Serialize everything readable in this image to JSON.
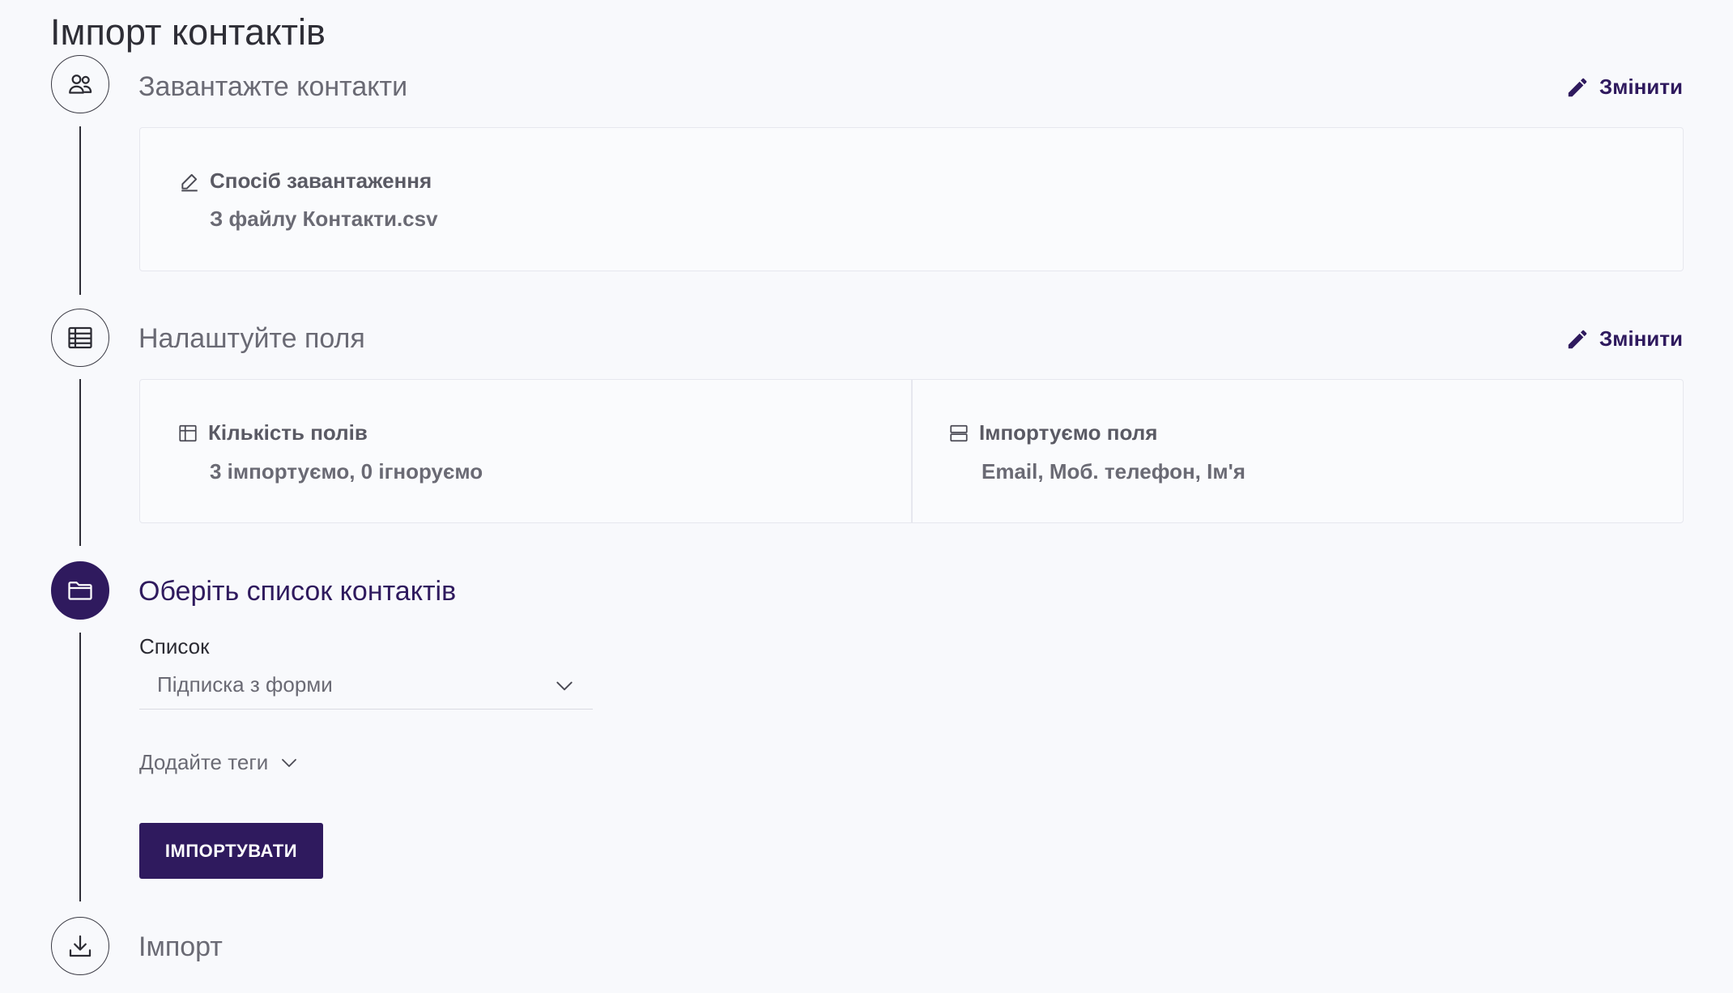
{
  "page": {
    "title": "Імпорт контактів"
  },
  "steps": [
    {
      "title": "Завантажте контакти",
      "icon": "users-icon",
      "edit_label": "Змінити",
      "info": [
        {
          "icon": "pencil-icon",
          "label": "Спосіб завантаження",
          "value": "З файлу Контакти.csv"
        }
      ]
    },
    {
      "title": "Налаштуйте поля",
      "icon": "table-icon",
      "edit_label": "Змінити",
      "info": [
        {
          "icon": "grid-icon",
          "label": "Кількість полів",
          "value": "3 імпортуємо, 0 ігноруємо"
        },
        {
          "icon": "rows-icon",
          "label": "Імпортуємо поля",
          "value": "Email, Моб. телефон, Ім'я"
        }
      ]
    },
    {
      "title": "Оберіть список контактів",
      "icon": "folder-icon",
      "list_label": "Список",
      "list_selected": "Підписка з форми",
      "tags_label": "Додайте теги",
      "import_button": "ІМПОРТУВАТИ"
    },
    {
      "title": "Імпорт",
      "icon": "download-icon"
    }
  ],
  "colors": {
    "accent": "#2f1a5e",
    "background": "#f8f9fc",
    "card_border": "#e6e7ee",
    "muted_text": "#6a6a74"
  }
}
